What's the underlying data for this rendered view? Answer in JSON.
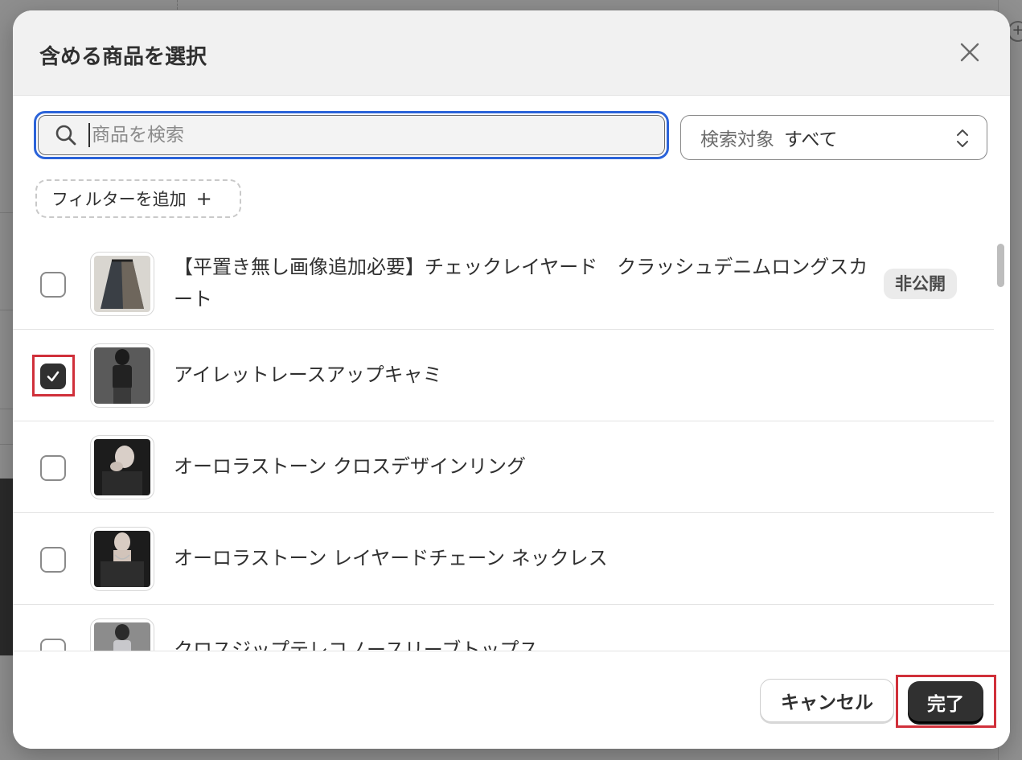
{
  "modal": {
    "title": "含める商品を選択",
    "close_icon": "close-icon"
  },
  "search": {
    "placeholder": "商品を検索",
    "value": "",
    "scope_label": "検索対象",
    "scope_value": "すべて"
  },
  "filter": {
    "label": "フィルターを追加",
    "plus": "+"
  },
  "products": [
    {
      "title": "【平置き無し画像追加必要】チェックレイヤード　クラッシュデニムロングスカート",
      "checked": false,
      "badge": "非公開"
    },
    {
      "title": "アイレットレースアップキャミ",
      "checked": true,
      "badge": ""
    },
    {
      "title": "オーロラストーン クロスデザインリング",
      "checked": false,
      "badge": ""
    },
    {
      "title": "オーロラストーン レイヤードチェーン ネックレス",
      "checked": false,
      "badge": ""
    },
    {
      "title": "クロスジップテレコノースリーブトップス",
      "checked": false,
      "badge": ""
    }
  ],
  "footer": {
    "cancel_label": "キャンセル",
    "done_label": "完了"
  },
  "colors": {
    "accent_focus": "#2b63d9",
    "highlight": "#d0303a",
    "primary_button": "#303030"
  }
}
